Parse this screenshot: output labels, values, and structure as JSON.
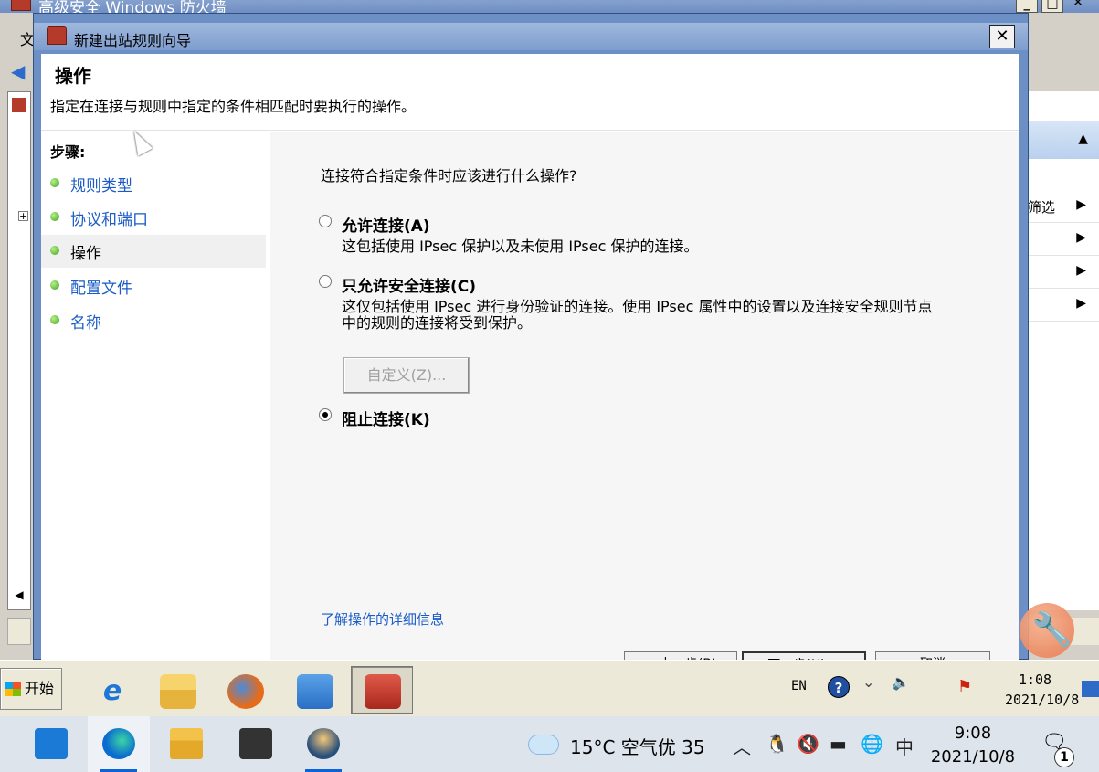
{
  "parent_window": {
    "title": "高级安全 Windows 防火墙",
    "menu_letter": "文",
    "right_pane": {
      "rows": [
        {
          "label": "筛选",
          "arrow": "▶"
        },
        {
          "label": "",
          "arrow": "▶"
        },
        {
          "label": "",
          "arrow": "▶"
        },
        {
          "label": "",
          "arrow": "▶"
        }
      ]
    }
  },
  "wizard": {
    "title": "新建出站规则向导",
    "close_glyph": "✕",
    "heading": "操作",
    "subheading": "指定在连接与规则中指定的条件相匹配时要执行的操作。",
    "steps_title": "步骤:",
    "steps": [
      {
        "label": "规则类型",
        "active": false
      },
      {
        "label": "协议和端口",
        "active": false
      },
      {
        "label": "操作",
        "active": true
      },
      {
        "label": "配置文件",
        "active": false
      },
      {
        "label": "名称",
        "active": false
      }
    ],
    "question": "连接符合指定条件时应该进行什么操作?",
    "options": [
      {
        "label": "允许连接(A)",
        "description": "这包括使用 IPsec 保护以及未使用 IPsec 保护的连接。",
        "checked": false
      },
      {
        "label": "只允许安全连接(C)",
        "description": "这仅包括使用 IPsec 进行身份验证的连接。使用 IPsec 属性中的设置以及连接安全规则节点中的规则的连接将受到保护。",
        "checked": false
      },
      {
        "label": "阻止连接(K)",
        "description": "",
        "checked": true
      }
    ],
    "customize_label": "自定义(Z)...",
    "learn_more": "了解操作的详细信息",
    "footer_buttons": [
      "< 上一步(B)",
      "下一步(N) >",
      "取消"
    ]
  },
  "legacy_taskbar": {
    "start_label": "开始",
    "lang": "EN",
    "help_glyph": "?",
    "time": "1:08",
    "date": "2021/10/8"
  },
  "taskbar": {
    "weather": "15°C  空气优 35",
    "ime": "中",
    "time": "9:08",
    "date": "2021/10/8",
    "notification_count": "1"
  },
  "colors": {
    "link": "#1a5bc8",
    "wizard_frame": "#6c8fc6",
    "helper_orange": "#e97a50"
  }
}
